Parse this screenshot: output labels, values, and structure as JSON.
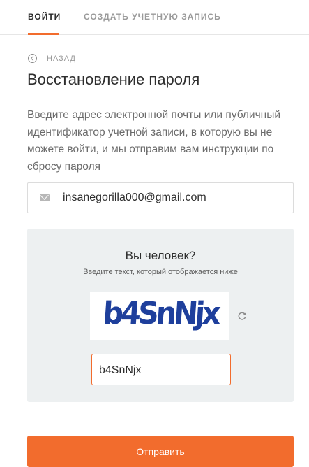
{
  "tabs": {
    "login": "ВОЙТИ",
    "create": "СОЗДАТЬ УЧЕТНУЮ ЗАПИСЬ"
  },
  "back_label": "НАЗАД",
  "title": "Восстановление пароля",
  "description": "Введите адрес электронной почты или публичный идентификатор учетной записи, в которую вы не можете войти, и мы отправим вам инструкции по сбросу пароля",
  "email": {
    "value": "insanegorilla000@gmail.com",
    "icon": "mail-icon"
  },
  "captcha": {
    "title": "Вы человек?",
    "hint": "Введите текст, который отображается ниже",
    "image_text": "b4SnNjx",
    "input_value": "b4SnNjx",
    "refresh_icon": "refresh-icon"
  },
  "submit_label": "Отправить",
  "colors": {
    "accent": "#f26c2d",
    "captcha_bg": "#edf0f1",
    "captcha_text": "#1e3f9c"
  }
}
